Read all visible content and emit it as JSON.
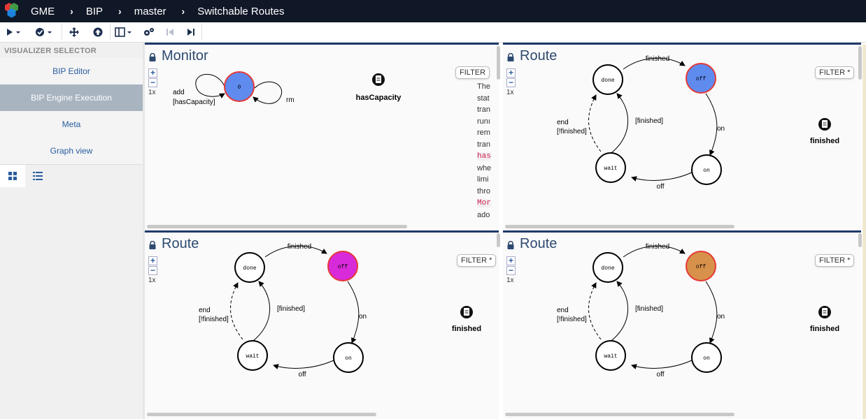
{
  "header": {
    "app": "GME",
    "crumbs": [
      "BIP",
      "master",
      "Switchable Routes"
    ]
  },
  "toolbar": {
    "icons": [
      "play-icon",
      "check-icon",
      "move-icon",
      "upload-icon",
      "layout-icon",
      "gears-icon",
      "step-back-icon",
      "step-forward-icon"
    ]
  },
  "sidebar": {
    "title": "VISUALIZER SELECTOR",
    "items": [
      {
        "label": "BIP Editor",
        "active": false
      },
      {
        "label": "BIP Engine Execution",
        "active": true
      },
      {
        "label": "Meta",
        "active": false
      },
      {
        "label": "Graph view",
        "active": false
      }
    ]
  },
  "panels": {
    "monitor": {
      "title": "Monitor",
      "zoom": "1x",
      "filter": "FILTER",
      "state": {
        "label": "0",
        "color": "#5f8bef"
      },
      "transitions": {
        "add": "add",
        "guard": "[hasCapacity]",
        "rm": "rm"
      },
      "badge": "hasCapacity",
      "doc": [
        {
          "text": "The",
          "code": false
        },
        {
          "text": "stat",
          "code": false
        },
        {
          "text": "tran",
          "code": false
        },
        {
          "text": "runı",
          "code": false
        },
        {
          "text": "rem",
          "code": false
        },
        {
          "text": "tran",
          "code": false
        },
        {
          "text": "has",
          "code": true
        },
        {
          "text": "whe",
          "code": false
        },
        {
          "text": "limi",
          "code": false
        },
        {
          "text": "thro",
          "code": false
        },
        {
          "text": "Mor",
          "code": true
        },
        {
          "text": "ado",
          "code": false
        }
      ]
    },
    "route_top_right": {
      "title": "Route",
      "zoom": "1x",
      "filter": "FILTER *",
      "badge": "finished",
      "active_color": "#5f8bef"
    },
    "route_bottom_left": {
      "title": "Route",
      "zoom": "1x",
      "filter": "FILTER *",
      "badge": "finished",
      "active_color": "#d92ad9"
    },
    "route_bottom_right": {
      "title": "Route",
      "zoom": "1x",
      "filter": "FILTER *",
      "badge": "finished",
      "active_color": "#d7914a"
    }
  },
  "route_graph": {
    "states": {
      "done": "done",
      "off": "off",
      "on": "on",
      "wait": "wait"
    },
    "transitions": {
      "finished": "finished",
      "on": "on",
      "off": "off",
      "finished_guard": "[finished]",
      "end": "end",
      "not_finished_guard": "[!finished]"
    }
  }
}
